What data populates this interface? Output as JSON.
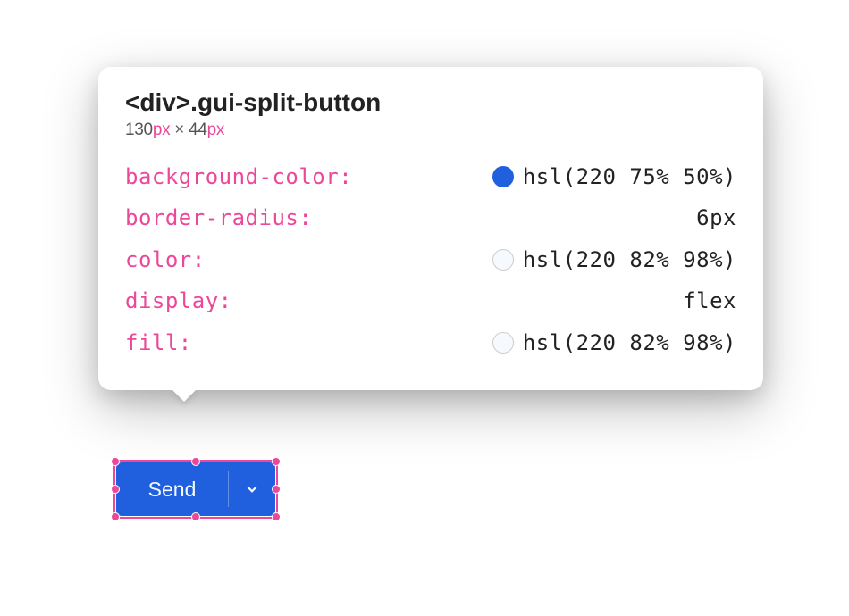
{
  "tooltip": {
    "selector": "<div>.gui-split-button",
    "dimensions": {
      "width": "130",
      "width_unit": "px",
      "times": " × ",
      "height": "44",
      "height_unit": "px"
    },
    "properties": [
      {
        "name": "background-color:",
        "value": "hsl(220 75% 50%)",
        "swatch": "filled"
      },
      {
        "name": "border-radius:",
        "value": "6px",
        "swatch": null
      },
      {
        "name": "color:",
        "value": "hsl(220 82% 98%)",
        "swatch": "light"
      },
      {
        "name": "display:",
        "value": "flex",
        "swatch": null
      },
      {
        "name": "fill:",
        "value": "hsl(220 82% 98%)",
        "swatch": "light"
      }
    ]
  },
  "button": {
    "label": "Send"
  }
}
